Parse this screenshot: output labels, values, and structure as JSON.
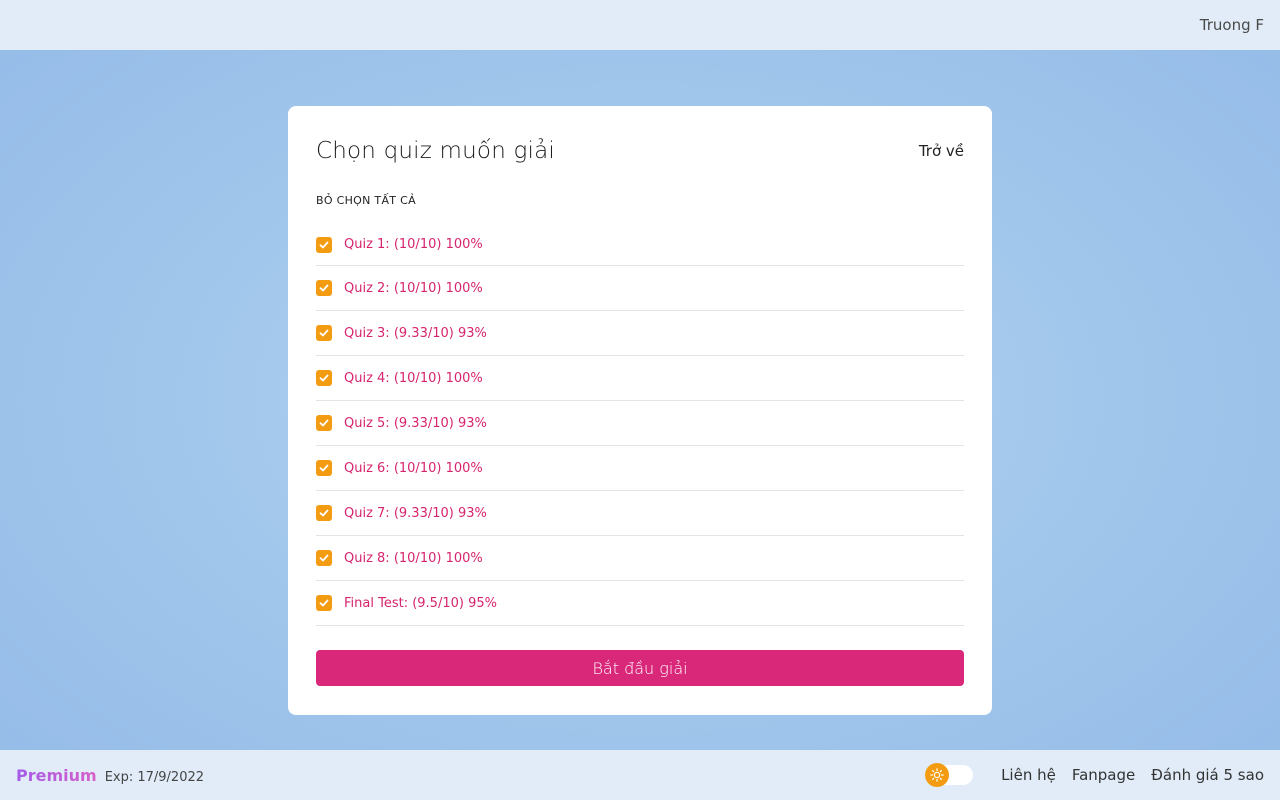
{
  "header": {
    "user_name": "Truong F"
  },
  "card": {
    "title": "Chọn quiz muốn giải",
    "back_label": "Trở về",
    "deselect_all_label": "BỎ CHỌN TẤT CẢ",
    "quizzes": [
      {
        "label": "Quiz 1: (10/10) 100%",
        "checked": true
      },
      {
        "label": "Quiz 2: (10/10) 100%",
        "checked": true
      },
      {
        "label": "Quiz 3: (9.33/10) 93%",
        "checked": true
      },
      {
        "label": "Quiz 4: (10/10) 100%",
        "checked": true
      },
      {
        "label": "Quiz 5: (9.33/10) 93%",
        "checked": true
      },
      {
        "label": "Quiz 6: (10/10) 100%",
        "checked": true
      },
      {
        "label": "Quiz 7: (9.33/10) 93%",
        "checked": true
      },
      {
        "label": "Quiz 8: (10/10) 100%",
        "checked": true
      },
      {
        "label": "Final Test: (9.5/10) 95%",
        "checked": true
      }
    ],
    "start_label": "Bắt đầu giải"
  },
  "footer": {
    "premium_label": "Premium",
    "exp_label": "Exp: 17/9/2022",
    "theme_toggle_icon": "sun-icon",
    "links": [
      "Liên hệ",
      "Fanpage",
      "Đánh giá 5 sao"
    ]
  },
  "colors": {
    "accent_pink": "#d92779",
    "checkbox_orange": "#f39c12",
    "quiz_text": "#d6246e"
  }
}
